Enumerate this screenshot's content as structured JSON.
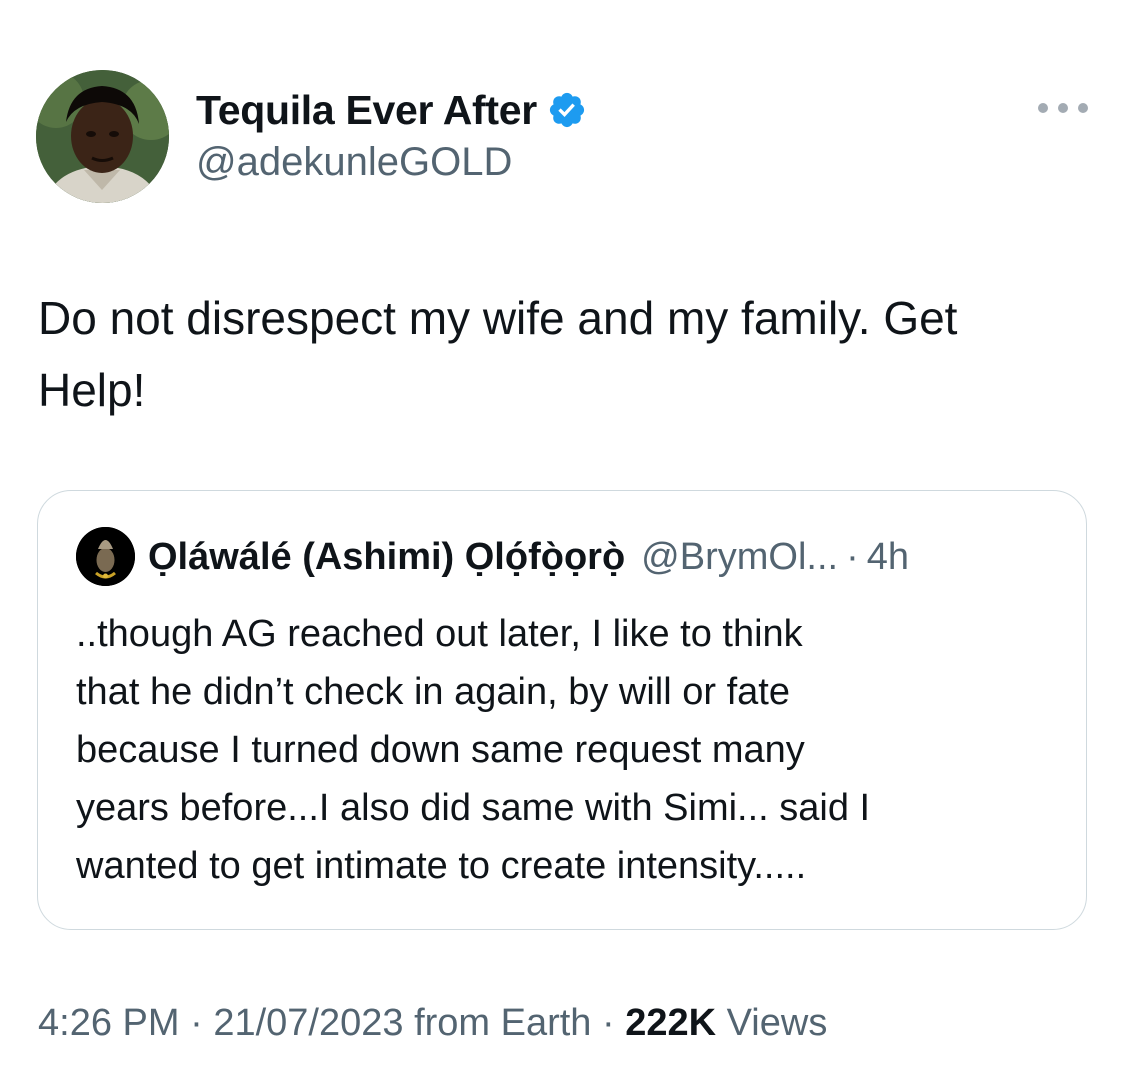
{
  "tweet": {
    "author": {
      "display_name": "Tequila Ever After",
      "handle": "@adekunleGOLD",
      "verified": true,
      "avatar_icon": "profile-photo"
    },
    "more_icon": "more-horizontal-icon",
    "text": "Do not disrespect my wife and my family. Get\nHelp!",
    "quoted": {
      "display_name": "Ọláwálé (Ashimi) Ọlọ́fọ̀ọrọ̀",
      "handle": "@BrymOl...",
      "separator": "·",
      "time": "4h",
      "avatar_icon": "profile-photo",
      "text": "..though AG reached out later, I like to think\nthat he didn’t check in again, by will or fate\nbecause I turned down same request many\nyears before...I also did same with Simi... said I\nwanted to get intimate to create intensity....."
    },
    "meta": {
      "time": "4:26 PM",
      "sep1": "·",
      "date": "21/07/2023",
      "source": "from Earth",
      "sep2": "·",
      "views_count": "222K",
      "views_label": "Views"
    }
  },
  "colors": {
    "text_primary": "#0f1419",
    "text_secondary": "#536471",
    "verified_blue": "#1d9bf0",
    "border": "#cfd9de"
  }
}
